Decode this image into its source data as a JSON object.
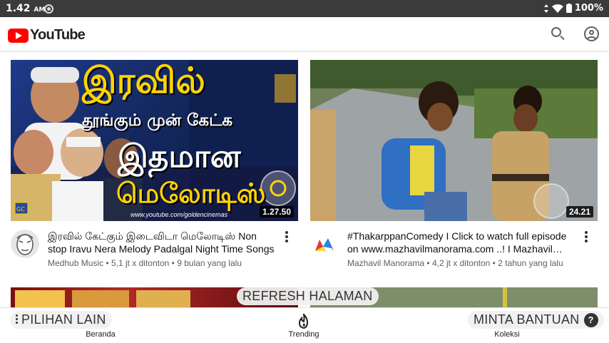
{
  "status_bar": {
    "time": "1.42",
    "ampm": "AM",
    "battery": "100%"
  },
  "app": {
    "logo_text": "YouTube"
  },
  "videos": [
    {
      "title": "இரவில் கேட்கும் இடைவிடா மெலோடிஸ் Non stop Iravu Nera Melody Padalgal Night Time Songs",
      "channel": "Medhub Music",
      "views": "5,1 jt x ditonton",
      "age": "9 bulan yang lalu",
      "duration": "1.27.50",
      "thumb_text": {
        "line1": "இரவில்",
        "line2": "தூங்கும் முன் கேட்க",
        "line3": "இதமான",
        "line4": "மெலோடிஸ்",
        "url": "www.youtube.com/goldencinemas",
        "badge": "GC"
      }
    },
    {
      "title": "#ThakarppanComedy I Click to watch full episode on www.mazhavilmanorama.com ..! I Mazhavil Manorama",
      "channel": "Mazhavil Manorama",
      "views": "4,2 jt x ditonton",
      "age": "2 tahun yang lalu",
      "duration": "24.21"
    }
  ],
  "separator": "•",
  "overlay": {
    "refresh": "REFRESH HALAMAN",
    "options": "PILIHAN LAIN",
    "help": "MINTA BANTUAN",
    "help_icon": "?"
  },
  "bottom_nav": [
    {
      "label": "Beranda",
      "icon": "home-icon"
    },
    {
      "label": "Trending",
      "icon": "trending-icon"
    },
    {
      "label": "Koleksi",
      "icon": "library-icon"
    }
  ],
  "colors": {
    "brand_red": "#ff0000",
    "thumb_yellow": "#ffd400",
    "subtext": "#606060"
  }
}
